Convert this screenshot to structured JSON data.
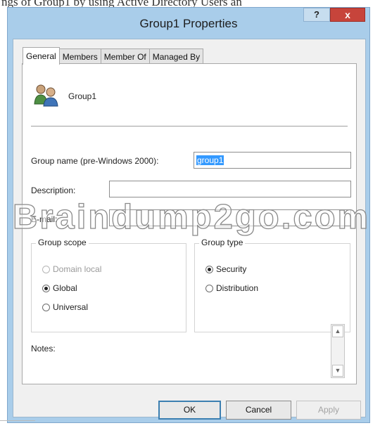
{
  "caption": "ngs of Group1 by using Active Directory Users an",
  "window": {
    "title": "Group1 Properties",
    "help_label": "?",
    "close_label": "x"
  },
  "tabs": [
    {
      "label": "General",
      "active": true
    },
    {
      "label": "Members",
      "active": false
    },
    {
      "label": "Member Of",
      "active": false
    },
    {
      "label": "Managed By",
      "active": false
    }
  ],
  "general": {
    "group_display_name": "Group1",
    "group_icon": "group-users-icon",
    "group_name_pre2000_label": "Group name (pre-Windows 2000):",
    "group_name_pre2000_value": "group1",
    "description_label": "Description:",
    "description_value": "",
    "email_label": "E-mail:",
    "email_value": "",
    "group_scope": {
      "title": "Group scope",
      "options": [
        {
          "label": "Domain local",
          "selected": false,
          "disabled": true
        },
        {
          "label": "Global",
          "selected": true,
          "disabled": false
        },
        {
          "label": "Universal",
          "selected": false,
          "disabled": false
        }
      ]
    },
    "group_type": {
      "title": "Group type",
      "options": [
        {
          "label": "Security",
          "selected": true
        },
        {
          "label": "Distribution",
          "selected": false
        }
      ]
    },
    "notes_label": "Notes:",
    "notes_value": ""
  },
  "buttons": {
    "ok": "OK",
    "cancel": "Cancel",
    "apply": "Apply"
  },
  "watermark": "Braindump2go.com",
  "colors": {
    "window_frame": "#a9cdea",
    "close_button": "#c7443b",
    "selection": "#3399ff"
  }
}
